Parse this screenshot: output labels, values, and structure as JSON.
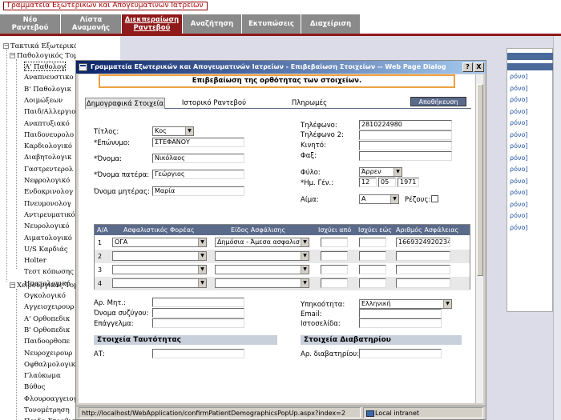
{
  "app": {
    "title": "Γραμματεία Εξωτερικών και Απογευματινών Ιατρείων"
  },
  "tabs": [
    {
      "line1": "Νέο",
      "line2": "Ραντεβού"
    },
    {
      "line1": "Λίστα",
      "line2": "Αναμονής"
    },
    {
      "line1": "Διεκπεραίωση",
      "line2": "Ραντεβού"
    },
    {
      "line1": "Αναζήτηση",
      "line2": ""
    },
    {
      "line1": "Εκτυπώσεις",
      "line2": ""
    },
    {
      "line1": "Διαχείριση",
      "line2": ""
    }
  ],
  "active_tab": "Διεκπεραίωση Ραντεβού",
  "tree": {
    "root": "Τακτικά Εξωτερικά Ιατρεία",
    "group1": "Παθολογικός Τομέας",
    "group1_items": [
      "Α' Παθολογ",
      "Αναπνευστικο",
      "Β' Παθολογικ",
      "Λοιμώξεων",
      "Παιδ/Αλλεργιο",
      "Αναπτυξιακό",
      "Παιδονευρολο",
      "Καρδιολογικό",
      "Διαβητολογικ",
      "Γαστρεντερολ",
      "Νεφρολογικό",
      "Ενδοκρινολογ",
      "Πνευμονολογ",
      "Αντιρευματικό",
      "Νευρολογικό",
      "Αιματολογικό",
      "U/S Καρδιάς",
      "Holter",
      "Τεστ κόπωσης",
      "Ηπατολογικό"
    ],
    "group2": "Χειρουργικός Τομ",
    "group2_items": [
      "Ογκολογικό",
      "Αγγειοχειρουρ",
      "Α' Ορθοπεδικ",
      "Β' Ορθοπεδικ",
      "Παιδοορθοπε",
      "Νευροχειρουρ",
      "Οφθαλμολογικό",
      "Γλαύκωμα",
      "Βύθος",
      "Φλουροαγγειογραφία",
      "Τονομέτρηση",
      "Παιδο-Στραβισμός"
    ]
  },
  "dialog": {
    "title": "Γραμματεία Εξωτερικών και Απογευματινών Ιατρείων - Επιβεβαίωση Στοιχείων -- Web Page Dialog",
    "help_btn": "?",
    "close_btn": "X",
    "confirm_text": "Επιβεβαίωση της ορθότητας των στοιχείων.",
    "tabs": [
      "Δημογραφικά Στοιχεία",
      "Ιστορικό Ραντεβού",
      "Πληρωμές"
    ],
    "save_label": "Αποθήκευση",
    "status_url": "http://localhost/WebApplication/confirmPatientDemographicsPopUp.aspx?index=2",
    "status_zone": "Local intranet"
  },
  "form": {
    "title_label": "Τίτλος:",
    "title_value": "Κος",
    "surname_label": "*Επώνυμο:",
    "surname_value": "ΣΤΕΦΑΝΟΥ",
    "name_label": "*Όνομα:",
    "name_value": "Νικόλαος",
    "father_label": "*Όνομα πατέρα:",
    "father_value": "Γεώργιος",
    "mother_label": "Όνομα μητέρας:",
    "mother_value": "Μαρία",
    "phone_label": "Τηλέφωνο:",
    "phone_value": "2810224980",
    "phone2_label": "Τηλέφωνο 2:",
    "phone2_value": "",
    "mobile_label": "Κινητό:",
    "mobile_value": "",
    "fax_label": "Φαξ:",
    "fax_value": "",
    "sex_label": "Φύλο:",
    "sex_value": "Άρρεν",
    "dob_label": "*Ημ. Γέν.:",
    "dob_day": "12",
    "dob_month": "05",
    "dob_year": "1971",
    "blood_label": "Αίμα:",
    "blood_value": "A",
    "rh_label": "Ρέζους:",
    "am_label": "Αρ. Μητ.:",
    "spouse_label": "Όνομα συζύγου:",
    "job_label": "Επάγγελμα:",
    "nation_label": "Υπηκοότητα:",
    "nation_value": "Ελληνική",
    "email_label": "Email:",
    "web_label": "Ιστοσελίδα:",
    "id_section": "Στοιχεία Ταυτότητας",
    "id_label": "ΑΤ:",
    "passport_section": "Στοιχεία Διαβατηρίου",
    "passport_label": "Αρ. διαβατηρίου:"
  },
  "insurance": {
    "headers": [
      "Α/Α",
      "Ασφαλιστικός Φορέας",
      "Είδος Ασφάλισης",
      "Ισχύει από",
      "Ισχύει εώς",
      "Αριθμός Ασφάλειας"
    ],
    "rows": [
      {
        "num": "1",
        "carrier": "ΟΓΑ",
        "type": "Δημόσια - Άμεσα ασφαλισ",
        "from": "",
        "to": "",
        "number": "1669324920234"
      },
      {
        "num": "2",
        "carrier": "",
        "type": "",
        "from": "",
        "to": "",
        "number": ""
      },
      {
        "num": "3",
        "carrier": "",
        "type": "",
        "from": "",
        "to": "",
        "number": ""
      },
      {
        "num": "4",
        "carrier": "",
        "type": "",
        "from": "",
        "to": "",
        "number": ""
      }
    ]
  },
  "background_links": [
    "ρόνο]",
    "ρόνο]",
    "ρόνο]",
    "ρόνο]",
    "ρόνο]",
    "ρόνο]",
    "ρόνο]",
    "ρόνο]",
    "ρόνο]",
    "ρόνο]",
    "ρόνο]",
    "ρόνο]",
    "ρόνο]",
    "ρόνο]"
  ],
  "colors": {
    "brand": "#8e1a1a",
    "tab": "#8a8a8a",
    "header": "#5a6a8a",
    "highlight": "#f0a040"
  }
}
